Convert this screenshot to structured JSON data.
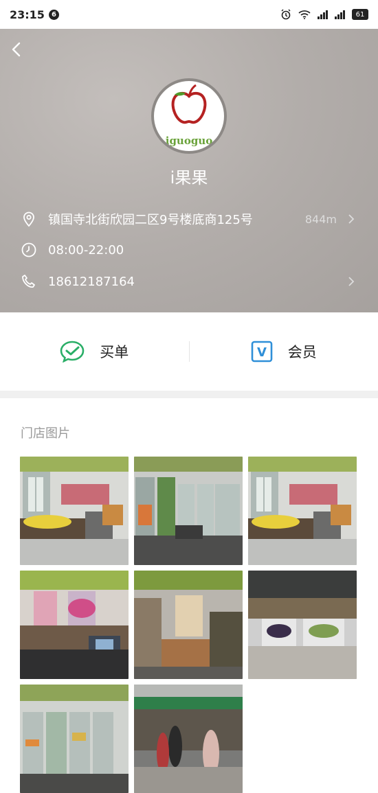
{
  "status_bar": {
    "time": "23:15",
    "notification_count": "6",
    "battery": "61"
  },
  "store": {
    "logo_text": "iguoguo",
    "name": "i果果",
    "address": "镇国寺北街欣园二区9号楼底商125号",
    "distance": "844m",
    "hours": "08:00-22:00",
    "phone": "18612187164"
  },
  "actions": {
    "pay_label": "买单",
    "member_label": "会员",
    "member_icon_letter": "V"
  },
  "gallery": {
    "title": "门店图片",
    "photos": [
      "store-photo-1",
      "store-photo-2",
      "store-photo-3",
      "store-photo-4",
      "store-photo-5",
      "store-photo-6",
      "store-photo-7",
      "store-photo-8"
    ]
  },
  "colors": {
    "wechat_green": "#2aae67",
    "member_blue": "#2f8fd8",
    "header_gray": "#b2adaa"
  }
}
